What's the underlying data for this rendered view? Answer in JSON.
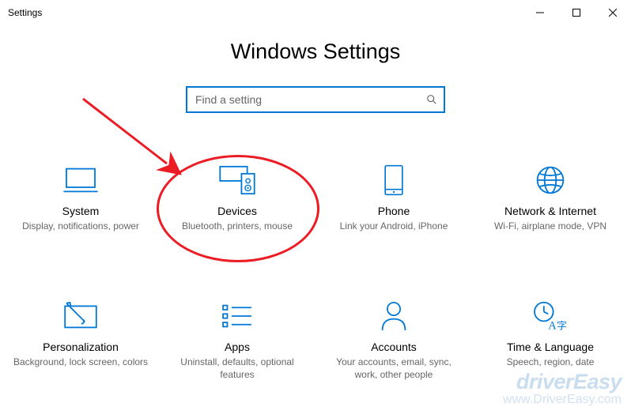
{
  "window": {
    "title": "Settings"
  },
  "header": {
    "page_title": "Windows Settings"
  },
  "search": {
    "placeholder": "Find a setting",
    "value": ""
  },
  "tiles": {
    "system": {
      "title": "System",
      "sub": "Display, notifications, power"
    },
    "devices": {
      "title": "Devices",
      "sub": "Bluetooth, printers, mouse"
    },
    "phone": {
      "title": "Phone",
      "sub": "Link your Android, iPhone"
    },
    "network": {
      "title": "Network & Internet",
      "sub": "Wi-Fi, airplane mode, VPN"
    },
    "personal": {
      "title": "Personalization",
      "sub": "Background, lock screen, colors"
    },
    "apps": {
      "title": "Apps",
      "sub": "Uninstall, defaults, optional features"
    },
    "accounts": {
      "title": "Accounts",
      "sub": "Your accounts, email, sync, work, other people"
    },
    "timelang": {
      "title": "Time & Language",
      "sub": "Speech, region, date"
    }
  },
  "watermark": {
    "brand": "driverEasy",
    "url": "www.DriverEasy.com"
  },
  "annotation": {
    "highlighted_tile": "devices",
    "arrow_color": "#ec1c24",
    "circle_color": "#ec1c24"
  },
  "colors": {
    "accent": "#0078d7",
    "annotation": "#ec1c24"
  }
}
